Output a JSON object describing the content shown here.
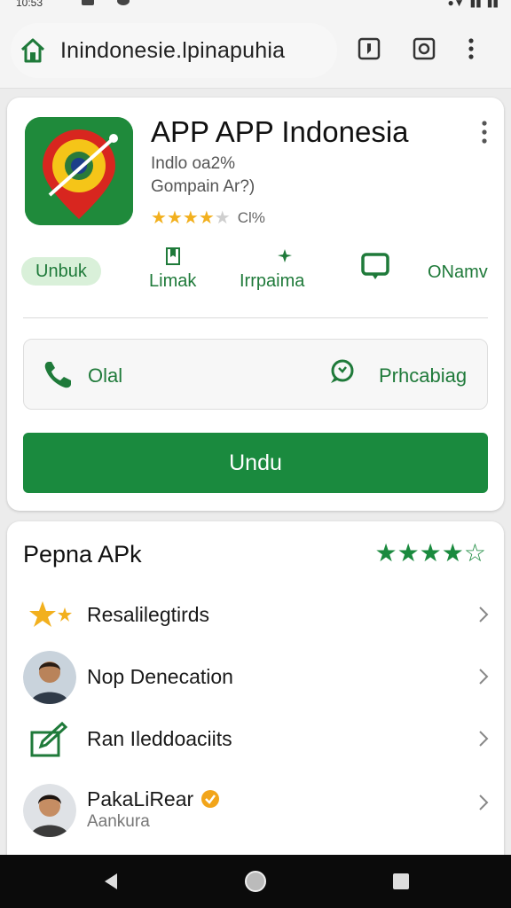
{
  "status_bar": {
    "time": "10:53"
  },
  "browser": {
    "url": "Inindonesie.lpinapuhia"
  },
  "app": {
    "title": "APP APP Indonesia",
    "meta_line1": "Indlo oa2%",
    "meta_line2": "Gompain Ar?)",
    "rating_stars": 4,
    "rating_text": "Cl%",
    "colors": {
      "accent": "#1a8a3e",
      "star": "#f2b01e"
    }
  },
  "actions": [
    {
      "label": "Unbuk",
      "icon": "pill"
    },
    {
      "label": "Limak",
      "icon": "bookmark-icon"
    },
    {
      "label": "Irrpaima",
      "icon": "sparkle-icon"
    },
    {
      "label": "",
      "icon": "chat-icon"
    },
    {
      "label": "ONamv",
      "icon": ""
    }
  ],
  "contact": {
    "call_label": "Olal",
    "chat_label": "Prhcabiag"
  },
  "install_label": "Undu",
  "section": {
    "title": "Pepna APk",
    "stars_filled": 4,
    "stars_total": 5,
    "items": [
      {
        "label": "Resalilegtirds",
        "icon": "stars-icon"
      },
      {
        "label": "Nop Denecation",
        "icon": "avatar"
      },
      {
        "label": "Ran Ileddoaciits",
        "icon": "edit-box-icon"
      },
      {
        "label": "PakaLiRear",
        "sublabel": "Aankura",
        "icon": "avatar",
        "verified": true
      }
    ]
  }
}
